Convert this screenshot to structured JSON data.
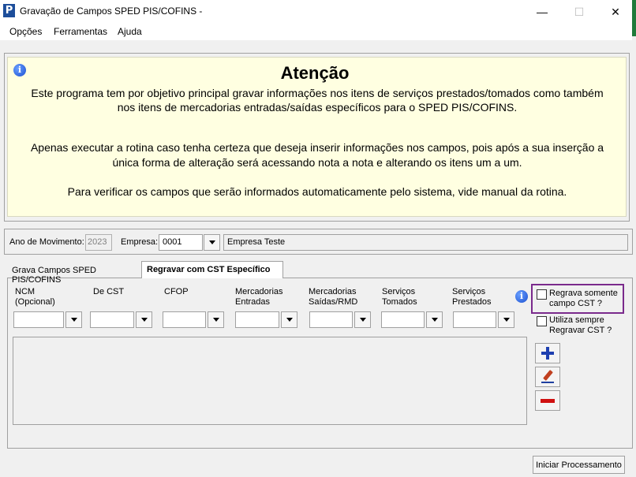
{
  "window": {
    "title": "Gravação de Campos SPED PIS/COFINS -",
    "minimize": "—",
    "maximize": "☐",
    "close": "✕",
    "app_icon": "P"
  },
  "menu": [
    "Opções",
    "Ferramentas",
    "Ajuda"
  ],
  "attention": {
    "title": "Atenção",
    "info_glyph": "i",
    "lines": [
      "Este programa tem por objetivo principal gravar informações nos itens de serviços prestados/tomados como também",
      "nos itens de mercadorias entradas/saídas específicos para o SPED PIS/COFINS.",
      "Apenas executar a rotina caso tenha certeza que deseja inserir informações nos campos, pois após a sua inserção a",
      "única forma de alteração será acessando nota a nota e alterando os itens um a um.",
      "Para verificar os campos que serão informados automaticamente pelo sistema, vide manual da rotina."
    ]
  },
  "filters": {
    "ano_label": "Ano de Movimento:",
    "ano_value": "2023",
    "empresa_label": "Empresa:",
    "empresa_code": "0001",
    "empresa_name": "Empresa Teste"
  },
  "tabs": [
    {
      "label": "Grava Campos SPED PIS/COFINS",
      "active": false
    },
    {
      "label": "Regravar com CST Específico",
      "active": true
    }
  ],
  "columns": [
    {
      "label": "NCM\n(Opcional)",
      "value": ""
    },
    {
      "label": "De CST",
      "value": ""
    },
    {
      "label": "CFOP",
      "value": ""
    },
    {
      "label": "Mercadorias\nEntradas",
      "value": ""
    },
    {
      "label": "Mercadorias\nSaídas/RMD",
      "value": ""
    },
    {
      "label": "Serviços\nTomados",
      "value": ""
    },
    {
      "label": "Serviços\nPrestados",
      "value": ""
    }
  ],
  "options": {
    "regrava_cst": {
      "label": "Regrava somente campo CST ?",
      "checked": false
    },
    "utiliza_sempre": {
      "label": "Utiliza sempre Regravar CST ?",
      "checked": false
    }
  },
  "actions": {
    "start_label": "Iniciar Processamento"
  },
  "icons": [
    "info-icon",
    "add-icon",
    "edit-icon",
    "remove-icon",
    "chevron-down-icon"
  ]
}
